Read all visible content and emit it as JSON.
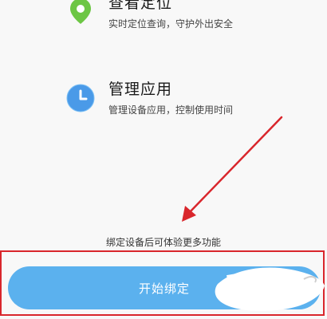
{
  "features": [
    {
      "icon": "location-pin-icon",
      "title": "查看定位",
      "description": "实时定位查询，守护外出安全"
    },
    {
      "icon": "clock-icon",
      "title": "管理应用",
      "description": "管理设备应用，控制使用时间"
    }
  ],
  "hint": "绑定设备后可体验更多功能",
  "start_button": {
    "label": "开始绑定"
  },
  "colors": {
    "accent": "#5bb1ee",
    "location_icon": "#6cc644",
    "annotation": "#d9262c"
  }
}
